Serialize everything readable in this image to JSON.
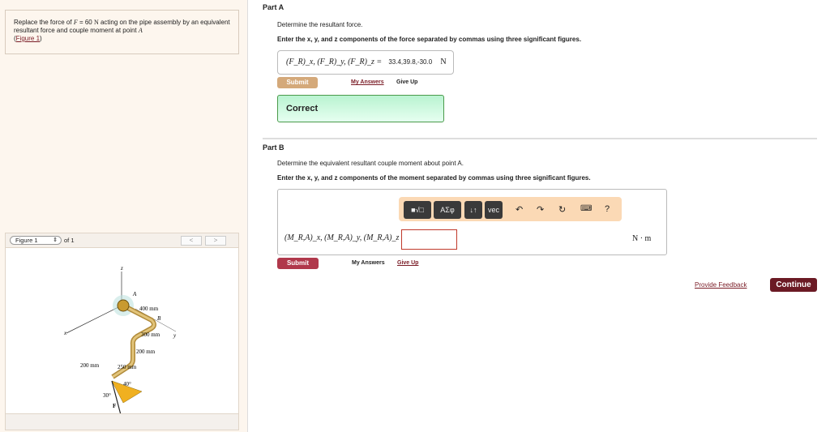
{
  "problem": {
    "text_before": "Replace the force of ",
    "F": "F",
    "eq": " = 60 ",
    "N": "N",
    "text_after": " acting on the pipe assembly by an equivalent resultant force and couple moment at point ",
    "A": "A",
    ".": ".",
    "figure_link": "Figure 1",
    "paren_open": "(",
    "paren_close": ")"
  },
  "figure": {
    "selector": "Figure 1",
    "of": "of 1",
    "prev": "<",
    "next": ">",
    "labels": {
      "z": "z",
      "x": "x",
      "y": "y",
      "A": "A",
      "B": "B",
      "d400": "400 mm",
      "d300": "300 mm",
      "d200a": "200 mm",
      "d200b": "200 mm",
      "d250": "250 mm",
      "a40": "40°",
      "a30": "30°",
      "F": "F"
    }
  },
  "partA": {
    "title": "Part A",
    "prompt": "Determine the resultant force.",
    "instruction": "Enter the x, y, and z components of the force separated by commas using three significant figures.",
    "label": "(F_R)_x, (F_R)_y, (F_R)_z =",
    "value": "33.4,39.8,-30.0",
    "unit": "N",
    "submit": "Submit",
    "my_answers": "My Answers",
    "give_up": "Give Up",
    "feedback": "Correct"
  },
  "partB": {
    "title": "Part B",
    "prompt": "Determine the equivalent resultant couple moment about point A.",
    "instruction": "Enter the x, y, and z components of the moment separated by commas using three significant figures.",
    "toolbar": {
      "templates": "■√□",
      "greek": "ΑΣφ",
      "arrows": "↓↑",
      "vec": "vec",
      "undo": "↶",
      "redo": "↷",
      "reset": "↻",
      "keyboard": "⌨",
      "help": "?"
    },
    "label": "(M_R,A)_x, (M_R,A)_y, (M_R,A)_z =",
    "value": "",
    "unit": "N · m",
    "submit": "Submit",
    "my_answers": "My Answers",
    "give_up": "Give Up"
  },
  "footer": {
    "feedback": "Provide Feedback",
    "continue": "Continue"
  },
  "colors": {
    "accent": "#7a1c26",
    "submit_a": "#d4a97a",
    "submit_b": "#b0384b",
    "continue": "#6b1a24"
  }
}
